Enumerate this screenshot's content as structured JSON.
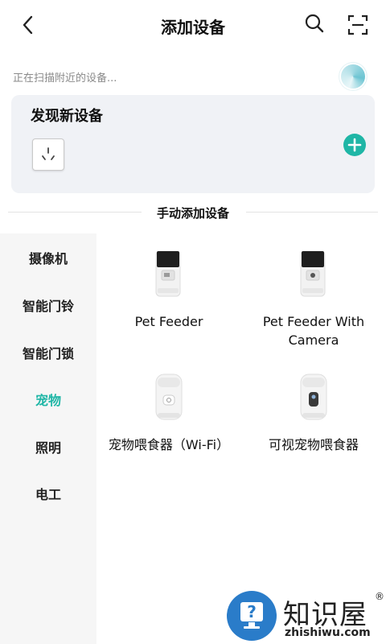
{
  "header": {
    "title": "添加设备",
    "icons": [
      "back-arrow-icon",
      "search-icon",
      "scan-icon"
    ]
  },
  "scan": {
    "status": "正在扫描附近的设备..."
  },
  "found": {
    "title": "发现新设备",
    "device_icon": "power-socket-icon",
    "add_icon": "plus-icon",
    "accent": "#1fb6a6"
  },
  "manual": {
    "title": "手动添加设备"
  },
  "sidebar": {
    "items": [
      {
        "label": "摄像机",
        "active": false
      },
      {
        "label": "智能门铃",
        "active": false
      },
      {
        "label": "智能门锁",
        "active": false
      },
      {
        "label": "宠物",
        "active": true
      },
      {
        "label": "照明",
        "active": false
      },
      {
        "label": "电工",
        "active": false
      }
    ]
  },
  "products": [
    {
      "label": "Pet Feeder",
      "icon": "pet-feeder-icon"
    },
    {
      "label": "Pet Feeder With Camera",
      "icon": "pet-feeder-camera-icon"
    },
    {
      "label": "宠物喂食器（Wi-Fi）",
      "icon": "pet-feeder-wifi-icon"
    },
    {
      "label": "可视宠物喂食器",
      "icon": "video-pet-feeder-icon"
    }
  ],
  "watermark": {
    "name": "知识屋",
    "url": "zhishiwu.com",
    "reg": "®"
  }
}
